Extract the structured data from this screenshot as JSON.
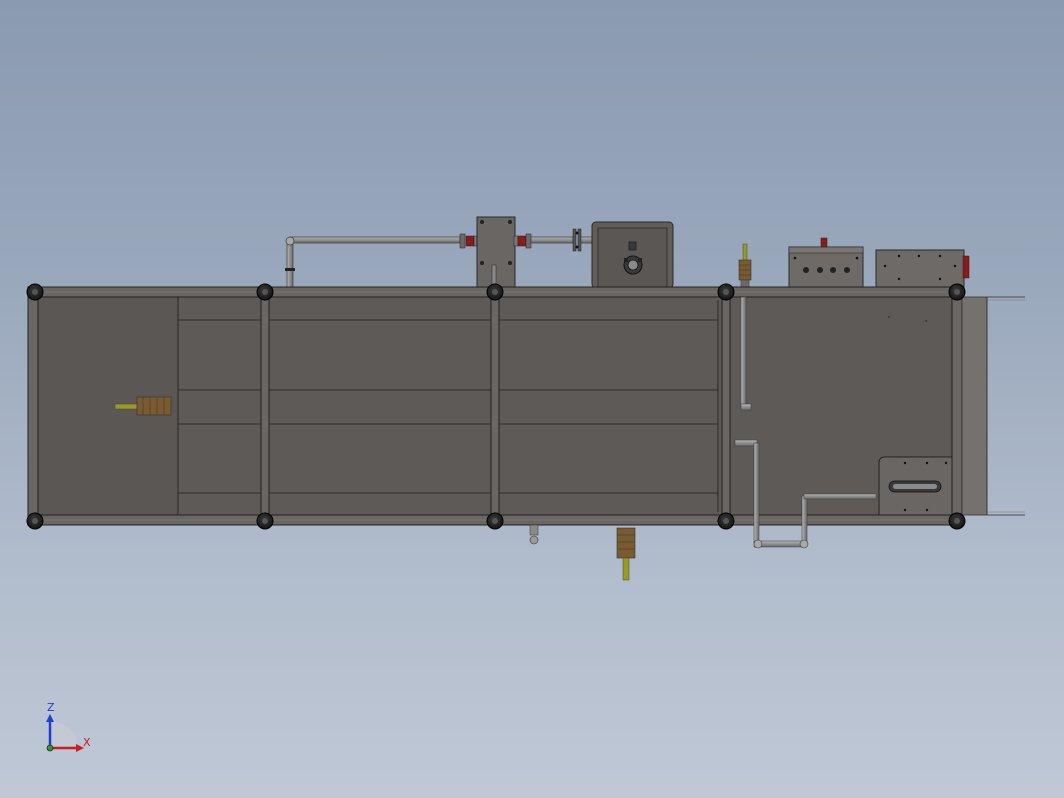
{
  "viewport": {
    "background_top": "#8a9ab0",
    "background_bottom": "#c0c8d6"
  },
  "model": {
    "frame_color": "#5a5654",
    "panel_color": "#5e5a57",
    "tube_color": "#8c8c8c",
    "valve_color": "#8b1a1a",
    "brass_color": "#7a5a30",
    "yellow_color": "#9a9a20"
  },
  "triad": {
    "z_label": "Z",
    "x_label": "X",
    "z_color": "#1f3fd0",
    "x_color": "#c81e1e"
  }
}
